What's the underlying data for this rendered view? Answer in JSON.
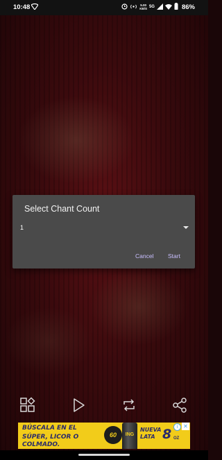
{
  "status_bar": {
    "time": "10:48",
    "speed_value": "5.00",
    "speed_unit": "KB/S",
    "network_label": "5G",
    "battery_percent": "86%",
    "icons": [
      "wifi-small-icon",
      "alarm-icon",
      "hotspot-icon",
      "signal-icon",
      "wifi-icon",
      "battery-icon"
    ]
  },
  "dialog": {
    "title": "Select Chant Count",
    "selected_value": "1",
    "cancel_label": "Cancel",
    "start_label": "Start"
  },
  "toolbar": {
    "icons": [
      "grid-shapes-icon",
      "play-icon",
      "repeat-icon",
      "share-icon"
    ]
  },
  "ad": {
    "line1": "BÚSCALA EN EL",
    "line2": "SÚPER, LICOR O COLMADO.",
    "badge": "60",
    "can_label": "ING",
    "right_line1": "NUEVA",
    "right_line2": "LATA",
    "size": "8",
    "size_unit": "OZ"
  },
  "colors": {
    "dialog_bg": "#4a4a4a",
    "dialog_button": "#c9bfff",
    "ad_bg": "#f2cc1a",
    "background": "#3a0a0d"
  }
}
